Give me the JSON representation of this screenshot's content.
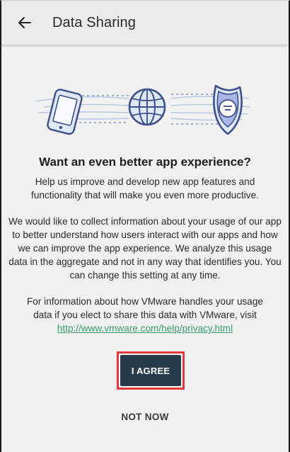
{
  "app_bar": {
    "title": "Data Sharing",
    "back_icon": "arrow-left-icon"
  },
  "hero": {
    "icons": [
      "phone-icon",
      "globe-icon",
      "shield-icon"
    ],
    "colors": {
      "stroke": "#3d4f8c",
      "fill": "#dfe8f7",
      "accent": "#a7b6e6"
    }
  },
  "content": {
    "headline": "Want an even better app experience?",
    "intro": "Help us improve and develop new app features and functionality that will make you even more productive.",
    "body": "We would like to collect information about your usage of our app to better understand how users interact with our apps and how we can improve the app experience. We analyze this usage data in the aggregate and not in any way that identifies you. You can change this setting at any time.",
    "info": "For information about how VMware handles your usage data if you elect to share this data with VMware, visit",
    "link": "http://www.vmware.com/help/privacy.html"
  },
  "actions": {
    "agree_label": "I AGREE",
    "not_now_label": "NOT NOW"
  },
  "colors": {
    "primary_button": "#263c4d",
    "highlight_border": "#e23a3a",
    "link": "#3a9e6a"
  }
}
